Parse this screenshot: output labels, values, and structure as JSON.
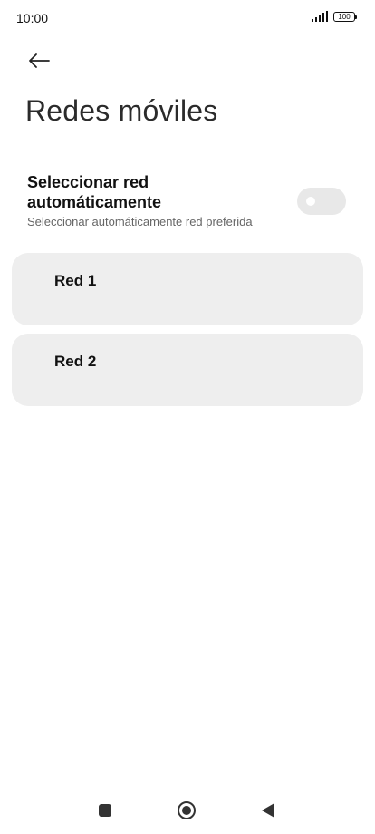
{
  "status_bar": {
    "time": "10:00",
    "battery": "100",
    "icons": [
      "signal-icon",
      "battery-icon"
    ]
  },
  "header": {
    "back_icon": "back-arrow-icon",
    "title": "Redes móviles"
  },
  "auto_select": {
    "title": "Seleccionar red automáticamente",
    "subtitle": "Seleccionar automáticamente red preferida",
    "enabled": false
  },
  "networks": [
    {
      "label": "Red 1"
    },
    {
      "label": "Red 2"
    }
  ],
  "nav_bar": {
    "icons": [
      "recents-icon",
      "home-icon",
      "back-icon"
    ]
  },
  "colors": {
    "card_background": "#eeeeee",
    "toggle_off": "#e8e8e8",
    "subtitle": "#666666"
  }
}
